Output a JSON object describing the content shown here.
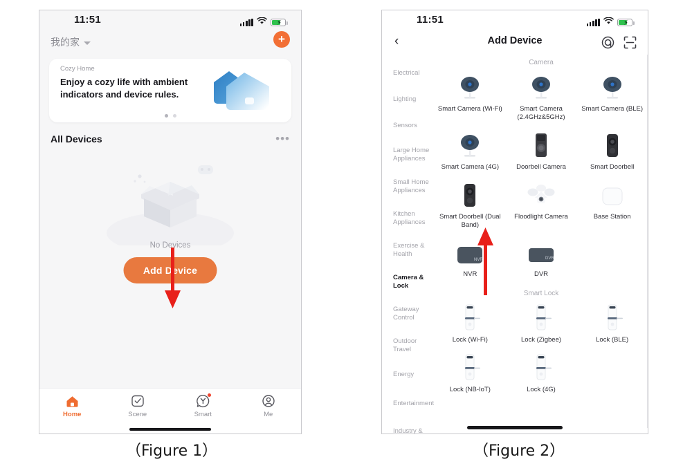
{
  "figure1": {
    "caption": "（Figure 1）",
    "status_bar": {
      "time": "11:51",
      "signal_icon": "signal-bars-icon",
      "wifi_icon": "wifi-icon",
      "battery_icon": "battery-charging-icon"
    },
    "header": {
      "home_name": "我的家",
      "dropdown_icon": "chevron-down-icon",
      "add_icon": "plus-icon"
    },
    "banner": {
      "tag": "Cozy Home",
      "headline": "Enjoy a cozy life with ambient indicators and device rules.",
      "illustration": "house-pair-icon",
      "page_dots": 2,
      "active_dot": 1
    },
    "devices_section": {
      "title": "All Devices",
      "more_icon": "more-horizontal-icon"
    },
    "empty_state": {
      "illustration": "empty-open-box-icon",
      "text": "No Devices",
      "add_device_label": "Add Device",
      "add_device_color": "#e8793f"
    },
    "tabbar": [
      {
        "label": "Home",
        "icon": "home-icon",
        "active": true,
        "badge": false
      },
      {
        "label": "Scene",
        "icon": "check-square-icon",
        "active": false,
        "badge": false
      },
      {
        "label": "Smart",
        "icon": "smart-automation-icon",
        "active": false,
        "badge": true
      },
      {
        "label": "Me",
        "icon": "user-circle-icon",
        "active": false,
        "badge": false
      }
    ]
  },
  "figure2": {
    "caption": "（Figure 2）",
    "status_bar": {
      "time": "11:51",
      "signal_icon": "signal-bars-icon",
      "wifi_icon": "wifi-icon",
      "battery_icon": "battery-charging-icon"
    },
    "navbar": {
      "back_icon": "chevron-left-icon",
      "title": "Add Device",
      "auto_scan_icon": "auto-scan-icon",
      "qr_scan_icon": "qr-scan-icon"
    },
    "categories": [
      {
        "label": "Electrical",
        "active": false
      },
      {
        "label": "Lighting",
        "active": false
      },
      {
        "label": "Sensors",
        "active": false
      },
      {
        "label": "Large Home Appliances",
        "active": false
      },
      {
        "label": "Small Home Appliances",
        "active": false
      },
      {
        "label": "Kitchen Appliances",
        "active": false
      },
      {
        "label": "Exercise & Health",
        "active": false
      },
      {
        "label": "Camera & Lock",
        "active": true
      },
      {
        "label": "Gateway Control",
        "active": false
      },
      {
        "label": "Outdoor Travel",
        "active": false
      },
      {
        "label": "Energy",
        "active": false
      },
      {
        "label": "Entertainment",
        "active": false
      },
      {
        "label": "Industry & Agriculture",
        "active": false
      }
    ],
    "sections": [
      {
        "title": "Camera",
        "items": [
          {
            "name": "Smart Camera (Wi-Fi)",
            "icon": "camera-dome-icon"
          },
          {
            "name": "Smart Camera (2.4GHz&5GHz)",
            "icon": "camera-dome-icon"
          },
          {
            "name": "Smart Camera (BLE)",
            "icon": "camera-dome-icon"
          },
          {
            "name": "Smart Camera (4G)",
            "icon": "camera-dome-icon"
          },
          {
            "name": "Doorbell Camera",
            "icon": "doorbell-camera-icon"
          },
          {
            "name": "Smart Doorbell",
            "icon": "smart-doorbell-icon"
          },
          {
            "name": "Smart Doorbell (Dual Band)",
            "icon": "smart-doorbell-icon"
          },
          {
            "name": "Floodlight Camera",
            "icon": "floodlight-camera-icon"
          },
          {
            "name": "Base Station",
            "icon": "base-station-icon"
          },
          {
            "name": "NVR",
            "icon": "nvr-icon"
          },
          {
            "name": "DVR",
            "icon": "dvr-icon"
          }
        ]
      },
      {
        "title": "Smart Lock",
        "items": [
          {
            "name": "Lock (Wi-Fi)",
            "icon": "door-lock-icon"
          },
          {
            "name": "Lock (Zigbee)",
            "icon": "door-lock-icon"
          },
          {
            "name": "Lock (BLE)",
            "icon": "door-lock-icon"
          },
          {
            "name": "Lock (NB-IoT)",
            "icon": "door-lock-icon"
          },
          {
            "name": "Lock (4G)",
            "icon": "door-lock-icon"
          }
        ]
      }
    ]
  },
  "annotations": {
    "color": "#e8201a",
    "arrows": [
      {
        "name": "arrow-to-add-device",
        "points_to": "Add Device"
      },
      {
        "name": "arrow-to-camera-lock",
        "points_to": "Camera & Lock"
      }
    ]
  }
}
